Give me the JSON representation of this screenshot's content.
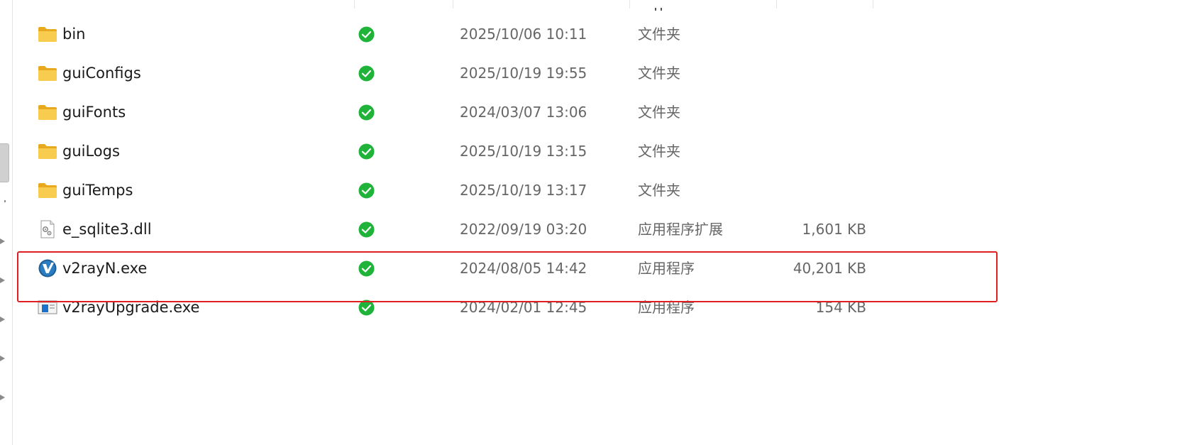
{
  "files": [
    {
      "name": "bin",
      "date": "2025/10/06 10:11",
      "type": "文件夹",
      "size": "",
      "icon": "folder-icon",
      "status_icon": "synced-check-icon"
    },
    {
      "name": "guiConfigs",
      "date": "2025/10/19 19:55",
      "type": "文件夹",
      "size": "",
      "icon": "folder-icon",
      "status_icon": "synced-check-icon"
    },
    {
      "name": "guiFonts",
      "date": "2024/03/07 13:06",
      "type": "文件夹",
      "size": "",
      "icon": "folder-icon",
      "status_icon": "synced-check-icon"
    },
    {
      "name": "guiLogs",
      "date": "2025/10/19 13:15",
      "type": "文件夹",
      "size": "",
      "icon": "folder-icon",
      "status_icon": "synced-check-icon"
    },
    {
      "name": "guiTemps",
      "date": "2025/10/19 13:17",
      "type": "文件夹",
      "size": "",
      "icon": "folder-icon",
      "status_icon": "synced-check-icon"
    },
    {
      "name": "e_sqlite3.dll",
      "date": "2022/09/19 03:20",
      "type": "应用程序扩展",
      "size": "1,601 KB",
      "icon": "dll-file-icon",
      "status_icon": "synced-check-icon"
    },
    {
      "name": "v2rayN.exe",
      "date": "2024/08/05 14:42",
      "type": "应用程序",
      "size": "40,201 KB",
      "icon": "v2rayn-app-icon",
      "status_icon": "synced-check-icon"
    },
    {
      "name": "v2rayUpgrade.exe",
      "date": "2024/02/01 12:45",
      "type": "应用程序",
      "size": "154 KB",
      "icon": "exe-window-icon",
      "status_icon": "synced-check-icon"
    }
  ],
  "highlighted_file": "v2rayN.exe",
  "colors": {
    "highlight_border": "#e02020",
    "status_green": "#1fb33a",
    "folder_yellow": "#f6c445",
    "text_primary": "#1a1a1a",
    "text_secondary": "#666666"
  }
}
